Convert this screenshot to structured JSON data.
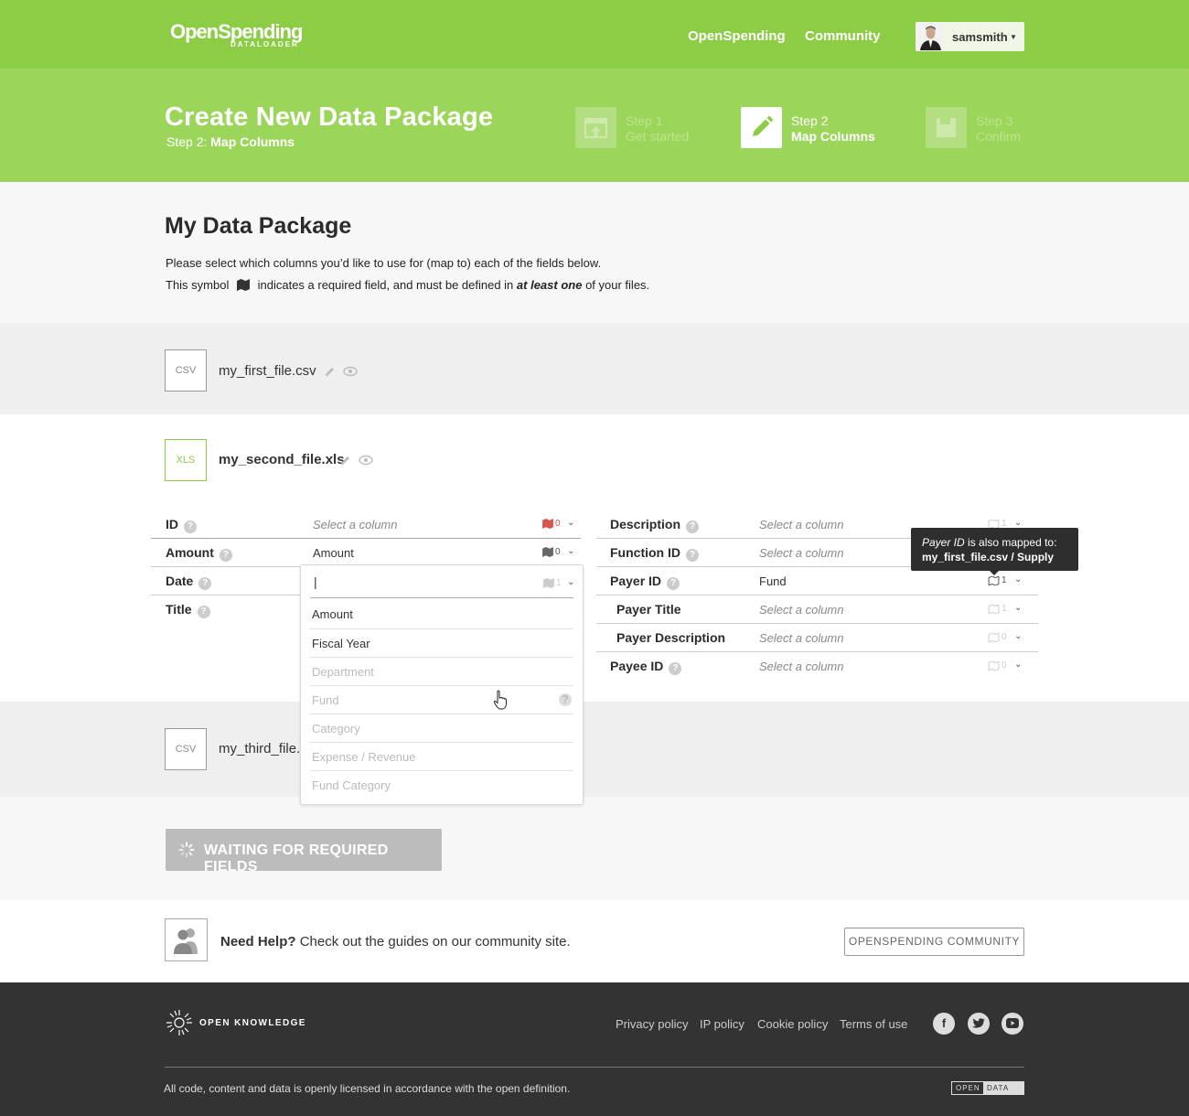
{
  "nav": {
    "logo_main": "OpenSpending",
    "logo_sub": "DATALOADER",
    "link_openspending": "OpenSpending",
    "link_community": "Community",
    "username": "samsmith"
  },
  "header": {
    "title": "Create New Data Package",
    "subtitle_prefix": "Step 2:",
    "subtitle_step": "Map Columns",
    "steps": [
      {
        "label": "Step 1",
        "name": "Get started"
      },
      {
        "label": "Step 2",
        "name": "Map Columns"
      },
      {
        "label": "Step 3",
        "name": "Confirm"
      }
    ]
  },
  "intro": {
    "title": "My Data Package",
    "line1": "Please select which columns you’d like to use for (map to) each of the fields below.",
    "line2_a": "This symbol",
    "line2_b": "indicates a required field, and must be defined in",
    "line2_em": "at least one",
    "line2_c": "of your files."
  },
  "files": [
    {
      "type": "CSV",
      "name": "my_first_file.csv"
    },
    {
      "type": "XLS",
      "name": "my_second_file.xls"
    },
    {
      "type": "CSV",
      "name": "my_third_file.csv"
    }
  ],
  "mapping_left": [
    {
      "label": "ID",
      "value": "Select a column",
      "count": "0"
    },
    {
      "label": "Amount",
      "value": "Amount",
      "count": "0"
    },
    {
      "label": "Date",
      "value": "|",
      "count": "1"
    },
    {
      "label": "Title",
      "value": "",
      "count": ""
    }
  ],
  "mapping_right": [
    {
      "label": "Description",
      "value": "Select a column",
      "count": "1"
    },
    {
      "label": "Function ID",
      "value": "Select a column",
      "count": ""
    },
    {
      "label": "Payer ID",
      "value": "Fund",
      "count": "1"
    },
    {
      "label": "Payer Title",
      "value": "Select a column",
      "count": "1"
    },
    {
      "label": "Payer Description",
      "value": "Select a column",
      "count": "0"
    },
    {
      "label": "Payee ID",
      "value": "Select a column",
      "count": "0"
    }
  ],
  "dropdown": {
    "options": [
      "Amount",
      "Fiscal Year",
      "Department",
      "Fund",
      "Category",
      "Expense / Revenue",
      "Fund Category"
    ],
    "enabled": [
      true,
      true,
      false,
      false,
      false,
      false,
      false
    ]
  },
  "tooltip": {
    "field": "Payer ID",
    "text": "is also mapped to:",
    "target": "my_first_file.csv / Supply"
  },
  "action": {
    "waiting_label": "WAITING FOR REQUIRED FIELDS"
  },
  "help": {
    "bold": "Need Help?",
    "text": "Check out the guides on our community site.",
    "button": "OPENSPENDING COMMUNITY"
  },
  "footer": {
    "org": "OPEN KNOWLEDGE",
    "links": [
      "Privacy policy",
      "IP policy",
      "Cookie policy",
      "Terms of use"
    ],
    "note": "All code, content and data is openly licensed in accordance with the open definition.",
    "badge_a": "OPEN",
    "badge_b": "DATA"
  },
  "colors": {
    "brand_green": "#8ccd45",
    "hero_green": "#9bd55a",
    "required_red": "#d9534f",
    "footer_bg": "#333333"
  }
}
